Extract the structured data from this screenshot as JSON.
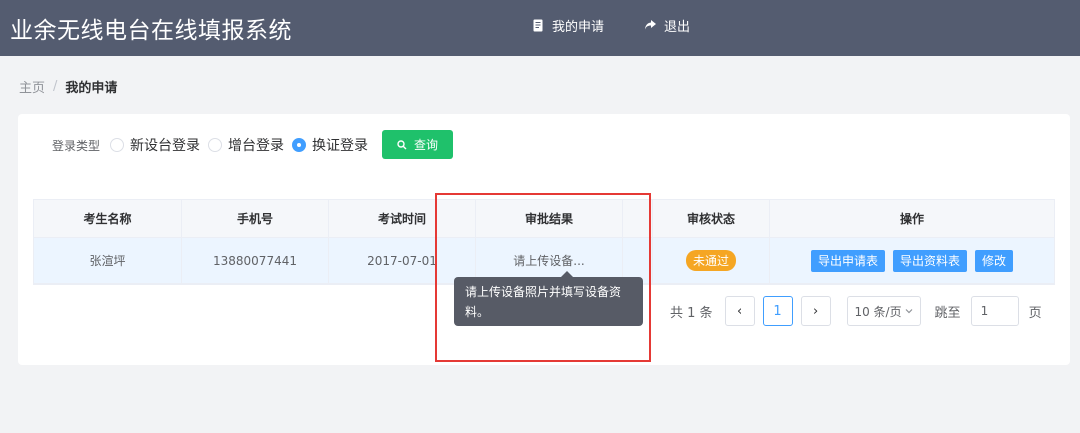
{
  "header": {
    "title": "业余无线电台在线填报系统",
    "nav": [
      {
        "label": "我的申请",
        "icon": "document-icon"
      },
      {
        "label": "退出",
        "icon": "share-arrow-icon"
      }
    ]
  },
  "breadcrumb": {
    "home": "主页",
    "separator": "/",
    "current": "我的申请"
  },
  "filter": {
    "label": "登录类型",
    "options": [
      {
        "label": "新设台登录",
        "checked": false
      },
      {
        "label": "增台登录",
        "checked": false
      },
      {
        "label": "换证登录",
        "checked": true
      }
    ],
    "query_label": "查询"
  },
  "table": {
    "columns": [
      "考生名称",
      "手机号",
      "考试时间",
      "审批结果",
      "审核状态",
      "操作"
    ],
    "rows": [
      {
        "name": "张渲坪",
        "phone": "13880077441",
        "exam_time": "2017-07-01",
        "result": "请上传设备...",
        "status": "未通过",
        "actions": [
          "导出申请表",
          "导出资料表",
          "修改"
        ]
      }
    ]
  },
  "tooltip": {
    "text": "请上传设备照片并填写设备资料。"
  },
  "pagination": {
    "total_text": "共 1 条",
    "prev": "‹",
    "current_page": "1",
    "next": "›",
    "page_size": "10 条/页",
    "jump_label": "跳至",
    "jump_value": "1",
    "page_unit": "页"
  },
  "colors": {
    "header_bg": "#545c70",
    "query_button": "#1fc16b",
    "primary": "#409eff",
    "status_badge": "#f5a623",
    "tooltip_bg": "#575b66",
    "highlight_border": "#e53935"
  }
}
